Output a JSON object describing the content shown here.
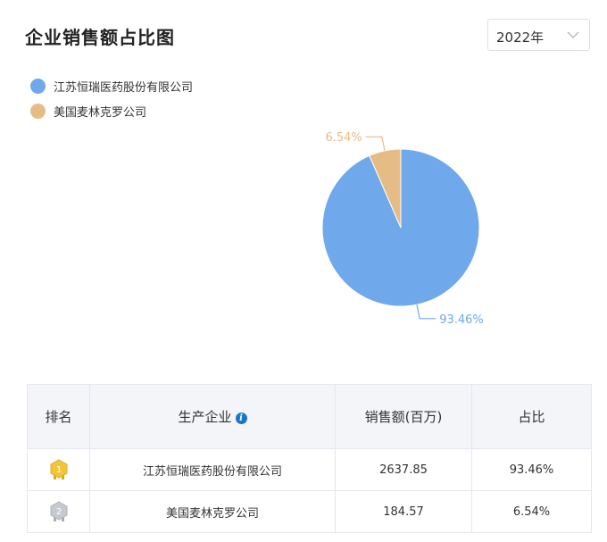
{
  "header": {
    "title": "企业销售额占比图"
  },
  "year_select": {
    "value": "2022年"
  },
  "colors": {
    "series1": "#6fa8eb",
    "series2": "#e6bc86",
    "info": "#1677c9"
  },
  "chart_data": {
    "type": "pie",
    "title": "",
    "series": [
      {
        "name": "江苏恒瑞医药股份有限公司",
        "value": 93.46,
        "label": "93.46%",
        "color": "#6fa8eb"
      },
      {
        "name": "美国麦林克罗公司",
        "value": 6.54,
        "label": "6.54%",
        "color": "#e6bc86"
      }
    ],
    "legend": "top-left"
  },
  "table": {
    "headers": [
      "排名",
      "生产企业",
      "销售额(百万)",
      "占比"
    ],
    "rows": [
      {
        "rank": "1",
        "company": "江苏恒瑞医药股份有限公司",
        "sales": "2637.85",
        "share": "93.46%"
      },
      {
        "rank": "2",
        "company": "美国麦林克罗公司",
        "sales": "184.57",
        "share": "6.54%"
      }
    ]
  }
}
